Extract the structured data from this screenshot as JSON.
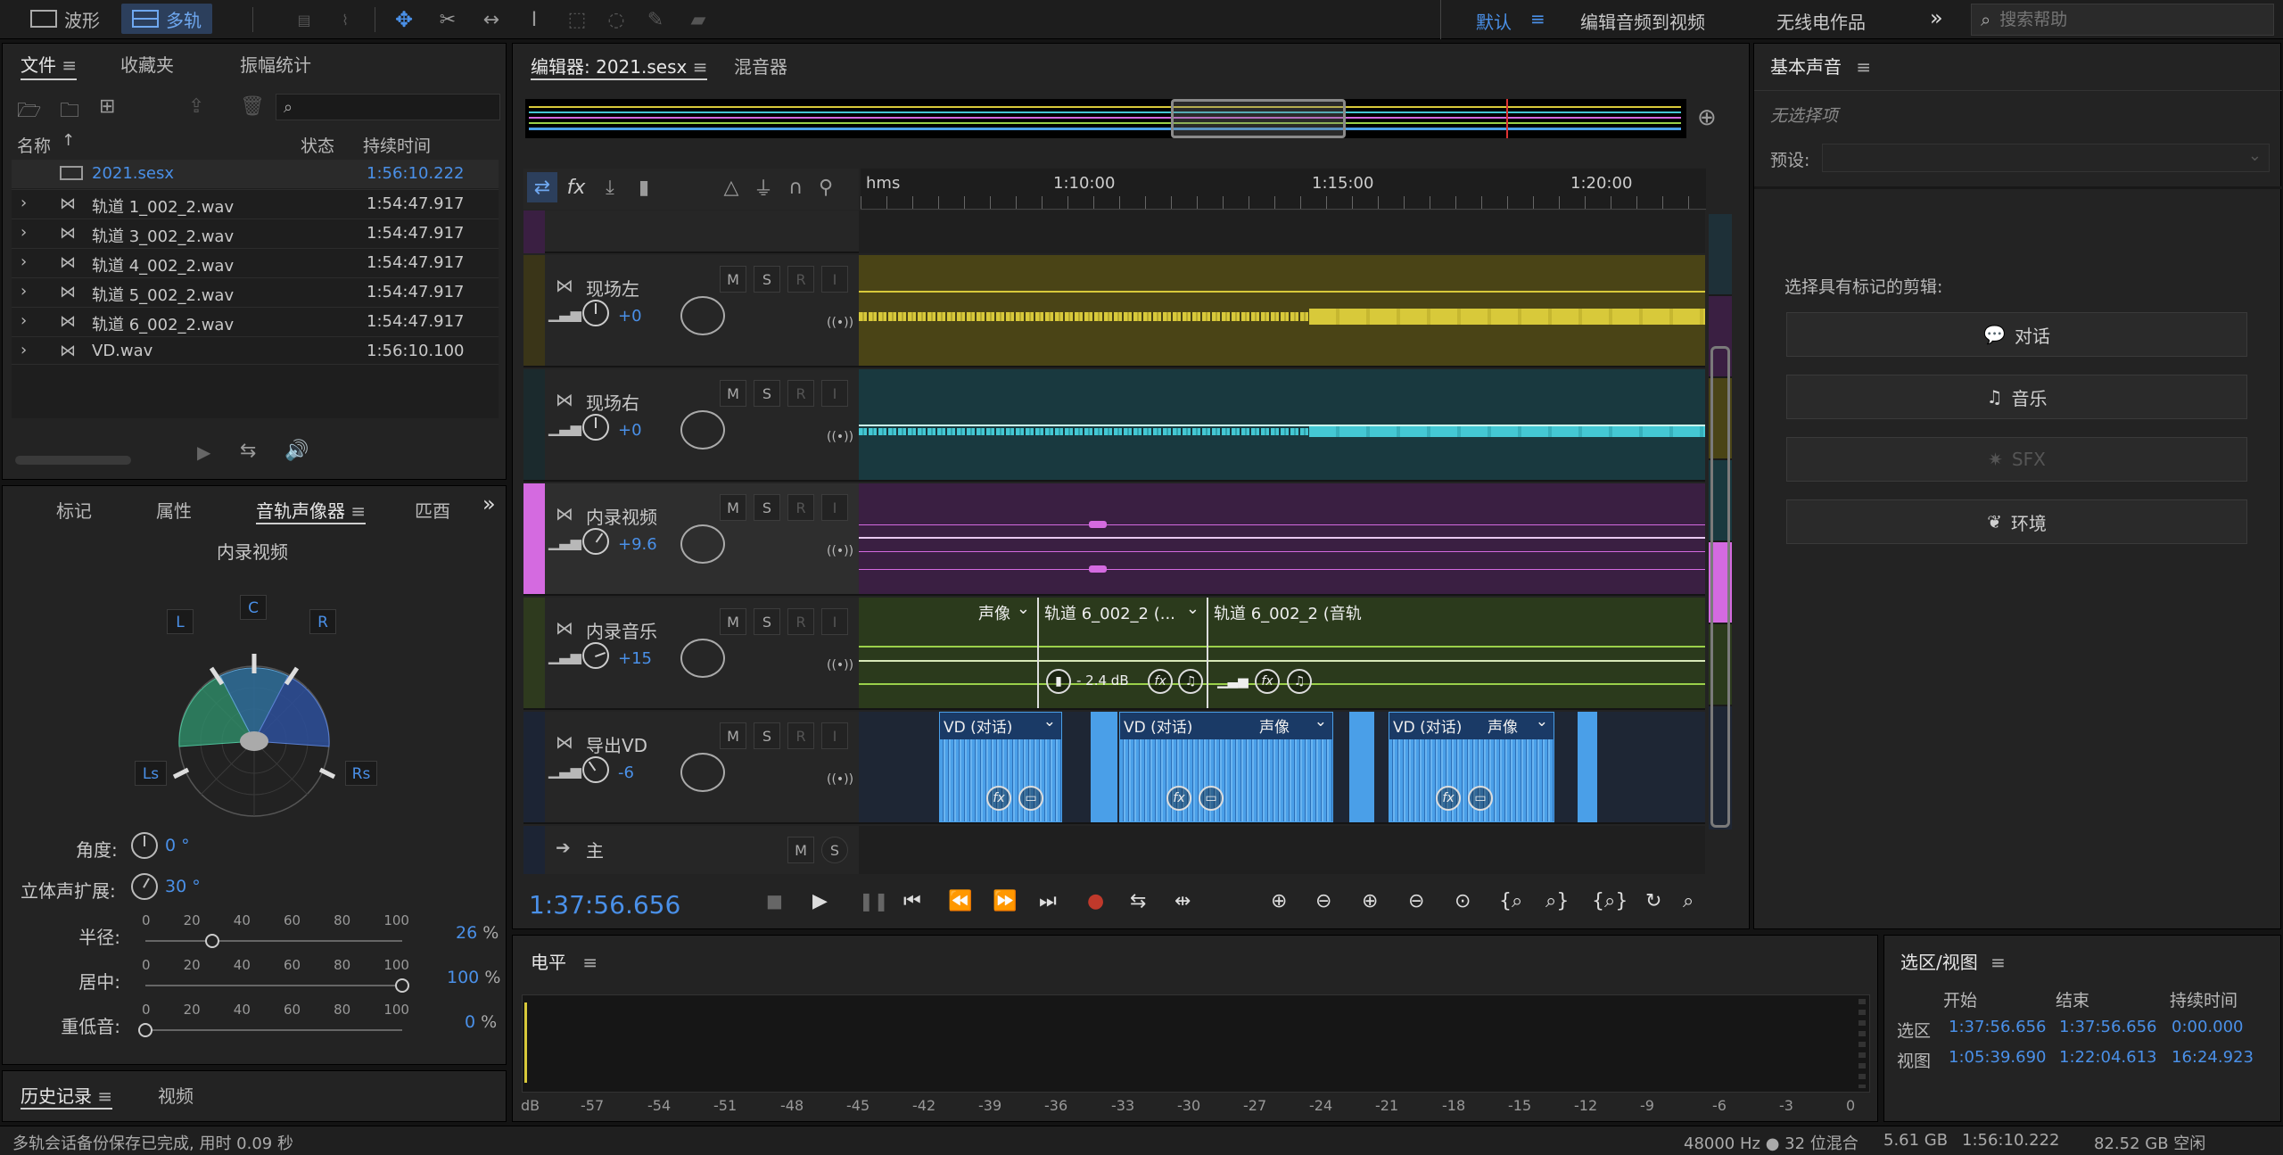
{
  "topbar": {
    "waveform": "波形",
    "multitrack": "多轨",
    "workspaces": [
      "默认",
      "编辑音频到视频",
      "无线电作品"
    ],
    "search_placeholder": "搜索帮助"
  },
  "files_panel": {
    "tabs": [
      "文件",
      "收藏夹",
      "振幅统计"
    ],
    "columns": [
      "名称",
      "状态",
      "持续时间"
    ],
    "rows": [
      {
        "name": "2021.sesx",
        "duration": "1:56:10.222"
      },
      {
        "name": "轨道 1_002_2.wav",
        "duration": "1:54:47.917"
      },
      {
        "name": "轨道 3_002_2.wav",
        "duration": "1:54:47.917"
      },
      {
        "name": "轨道 4_002_2.wav",
        "duration": "1:54:47.917"
      },
      {
        "name": "轨道 5_002_2.wav",
        "duration": "1:54:47.917"
      },
      {
        "name": "轨道 6_002_2.wav",
        "duration": "1:54:47.917"
      },
      {
        "name": "VD.wav",
        "duration": "1:56:10.100"
      }
    ]
  },
  "panner": {
    "tabs": [
      "标记",
      "属性",
      "音轨声像器",
      "匹酉"
    ],
    "track_name": "内录视频",
    "speakers": {
      "l": "L",
      "c": "C",
      "r": "R",
      "ls": "Ls",
      "rs": "Rs"
    },
    "angle_label": "角度:",
    "angle_value": "0 °",
    "stereo_label": "立体声扩展:",
    "stereo_value": "30 °",
    "sliders": [
      {
        "label": "半径:",
        "value": "26",
        "pct": 26,
        "unit": "%"
      },
      {
        "label": "居中:",
        "value": "100",
        "pct": 100,
        "unit": "%"
      },
      {
        "label": "重低音:",
        "value": "0",
        "pct": 0,
        "unit": "%"
      }
    ],
    "scale": [
      "0",
      "20",
      "40",
      "60",
      "80",
      "100"
    ]
  },
  "history_tabs": [
    "历史记录",
    "视频"
  ],
  "editor": {
    "tabs": [
      "编辑器: 2021.sesx",
      "混音器"
    ],
    "ruler": [
      "hms",
      "1:10:00",
      "1:15:00",
      "1:20:00"
    ],
    "time": "1:37:56.656",
    "tracks": [
      {
        "name": "现场左",
        "vol": "+0",
        "color": "#4a4416",
        "bar": "#3a3518",
        "wave": "#d8c93a"
      },
      {
        "name": "现场右",
        "vol": "+0",
        "color": "#19393f",
        "bar": "#1b2a2d",
        "wave": "#44c8d4"
      },
      {
        "name": "内录视频",
        "vol": "+9.6",
        "color": "#3a1f42",
        "bar": "#d46ae0",
        "wave": "#d46ae0"
      },
      {
        "name": "内录音乐",
        "vol": "+15",
        "color": "#2b3a1c",
        "bar": "#2e3a1e",
        "wave": "#9bd04a"
      },
      {
        "name": "导出VD",
        "vol": "-6",
        "color": "#1e2634",
        "bar": "#1c2434",
        "wave": "#4a9fe8"
      }
    ],
    "master": "主",
    "music_clips": [
      {
        "label": "声像"
      },
      {
        "label": "轨道 6_002_2 (..."
      },
      {
        "label": "轨道 6_002_2 (音轨"
      }
    ],
    "music_clip_gain": "- 2.4 dB",
    "vd_clips": [
      {
        "label": "VD (对话)"
      },
      {
        "label": "VD (对话)",
        "extra": "声像"
      },
      {
        "label": "VD (对话)",
        "extra": "声像"
      }
    ],
    "msri": [
      "M",
      "S",
      "R",
      "I"
    ]
  },
  "levels": {
    "title": "电平",
    "scale": [
      "dB",
      "-57",
      "-54",
      "-51",
      "-48",
      "-45",
      "-42",
      "-39",
      "-36",
      "-33",
      "-30",
      "-27",
      "-24",
      "-21",
      "-18",
      "-15",
      "-12",
      "-9",
      "-6",
      "-3",
      "0"
    ]
  },
  "essential": {
    "title": "基本声音",
    "no_selection": "无选择项",
    "preset_label": "预设:",
    "prompt": "选择具有标记的剪辑:",
    "buttons": [
      "对话",
      "音乐",
      "SFX",
      "环境"
    ]
  },
  "selection": {
    "title": "选区/视图",
    "cols": [
      "开始",
      "结束",
      "持续时间"
    ],
    "rows": [
      {
        "label": "选区",
        "start": "1:37:56.656",
        "end": "1:37:56.656",
        "dur": "0:00.000"
      },
      {
        "label": "视图",
        "start": "1:05:39.690",
        "end": "1:22:04.613",
        "dur": "16:24.923"
      }
    ]
  },
  "status": {
    "message": "多轨会话备份保存已完成, 用时 0.09 秒",
    "rate": "48000 Hz ● 32 位混合",
    "size": "5.61 GB",
    "duration": "1:56:10.222",
    "free": "82.52 GB 空闲"
  }
}
